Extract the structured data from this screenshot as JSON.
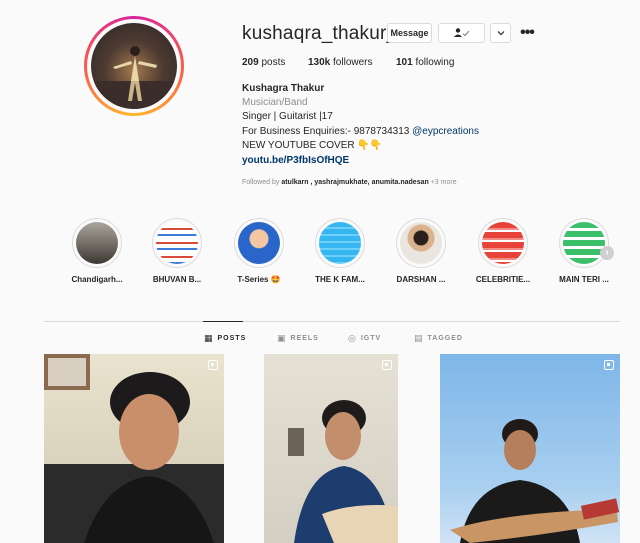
{
  "profile": {
    "username": "kushaqra_thakur__",
    "message_label": "Message",
    "full_name": "Kushagra Thakur",
    "category": "Musician/Band",
    "bio_line1": "Singer | Guitarist |17",
    "bio_line2": "For Business Enquiries:- 9878734313",
    "bio_mention": "@eypcreations",
    "bio_line3": "NEW YOUTUBE COVER",
    "bio_emoji": "👇👇",
    "bio_link": "youtu.be/P3fbIsOfHQE",
    "followed_by_prefix": "Followed by",
    "followed_by_names": "atulkarn , yashrajmukhate, anumita.nadesan",
    "followed_by_suffix": "+3 more"
  },
  "stats": {
    "posts_count": "209",
    "posts_label": "posts",
    "followers_count": "130k",
    "followers_label": "followers",
    "following_count": "101",
    "following_label": "following"
  },
  "highlights": [
    {
      "label": "Chandigarh..."
    },
    {
      "label": "BHUVAN B..."
    },
    {
      "label": "T-Series 🤩"
    },
    {
      "label": "THE K FAM..."
    },
    {
      "label": "DARSHAN ..."
    },
    {
      "label": "CELEBRITIE..."
    },
    {
      "label": "MAIN TERI ..."
    }
  ],
  "tabs": [
    {
      "label": "POSTS",
      "active": true
    },
    {
      "label": "REELS",
      "active": false
    },
    {
      "label": "IGTV",
      "active": false
    },
    {
      "label": "TAGGED",
      "active": false
    }
  ],
  "icons": {
    "more": "more-horizontal-icon",
    "follow": "person-check-icon",
    "dropdown": "chevron-down-icon",
    "next": "chevron-right-icon"
  },
  "colors": {
    "accent_link": "#00376b",
    "muted": "#8e8e8e",
    "border": "#dbdbdb"
  }
}
